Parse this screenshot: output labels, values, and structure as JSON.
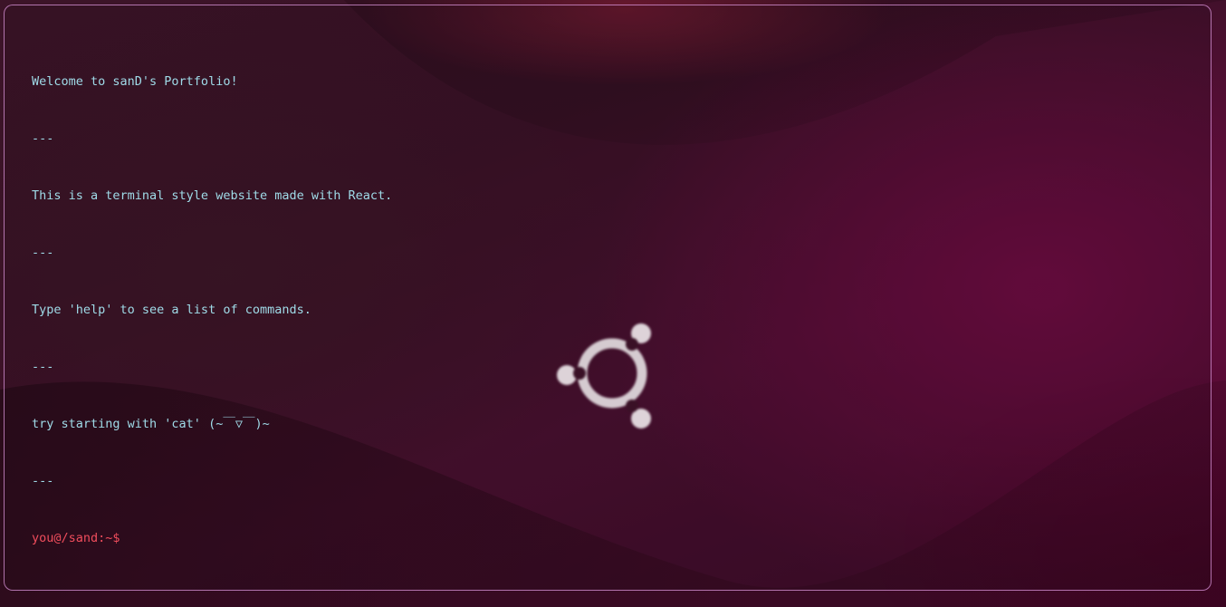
{
  "terminal": {
    "lines": [
      "Welcome to sanD's Portfolio!",
      "---",
      "This is a terminal style website made with React.",
      "---",
      "Type 'help' to see a list of commands.",
      "---",
      "try starting with 'cat' (~￣▽￣)~",
      "---"
    ],
    "prompt": "you@/sand:~$",
    "input_value": ""
  },
  "wallpaper": {
    "logo_icon": "ubuntu-logo-icon",
    "colors": {
      "base": "#3a1126",
      "accent": "#b4284a",
      "text": "#9fdbe8",
      "prompt": "#f04d5c"
    }
  }
}
